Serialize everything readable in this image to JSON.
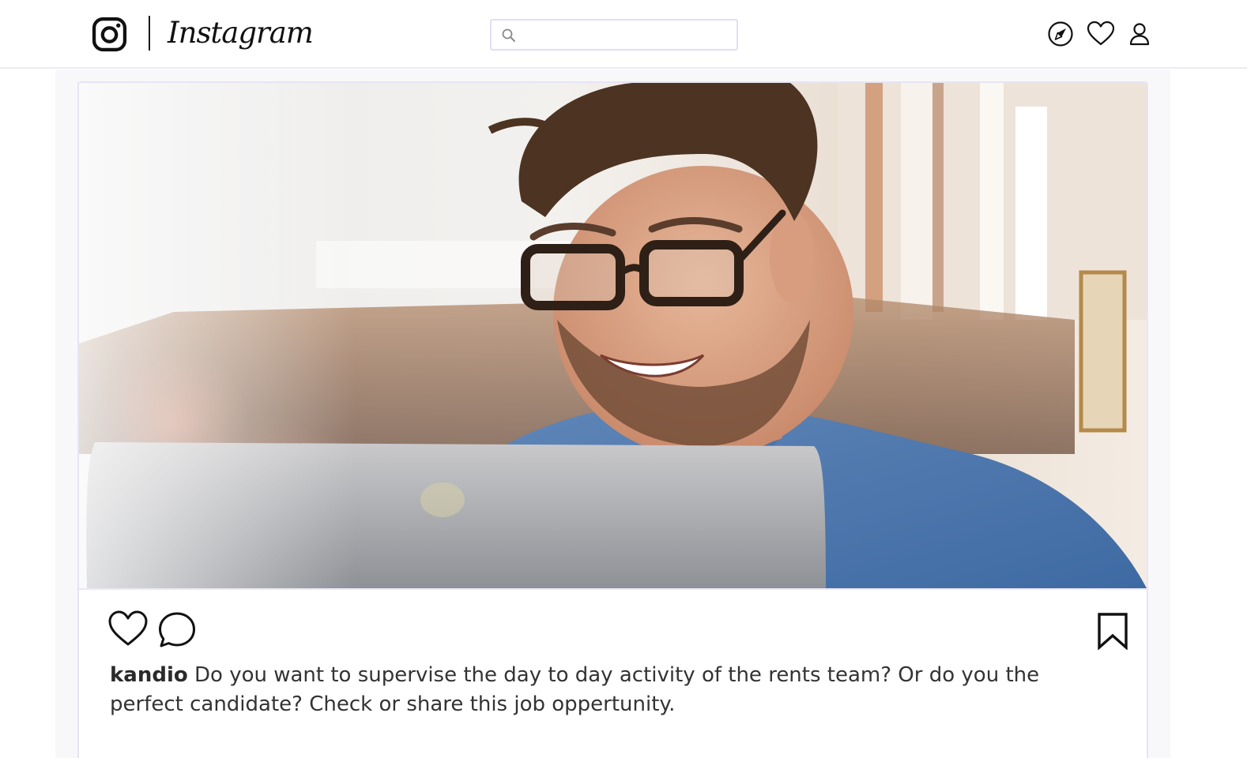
{
  "header": {
    "logo_icon": "instagram-camera-icon",
    "wordmark": "Instagram",
    "search": {
      "value": "",
      "placeholder": "",
      "icon": "search-icon"
    },
    "nav_icons": [
      "compass-explore-icon",
      "heart-activity-icon",
      "user-profile-icon"
    ]
  },
  "post": {
    "image": {
      "description_icon": "post-photo",
      "subject": "smiling-man-with-glasses-at-laptop"
    },
    "actions": {
      "like_icon": "heart-icon",
      "comment_icon": "comment-bubble-icon",
      "save_icon": "bookmark-icon"
    },
    "caption": {
      "username": "kandio",
      "text": "Do you want to supervise the day to day activity of the rents team? Or do you the perfect candidate? Check or share this job oppertunity."
    }
  },
  "colors": {
    "border": "#e7e4f4",
    "feed_background": "#f8f8fa",
    "icon": "#111111",
    "caption_text": "#333333"
  }
}
